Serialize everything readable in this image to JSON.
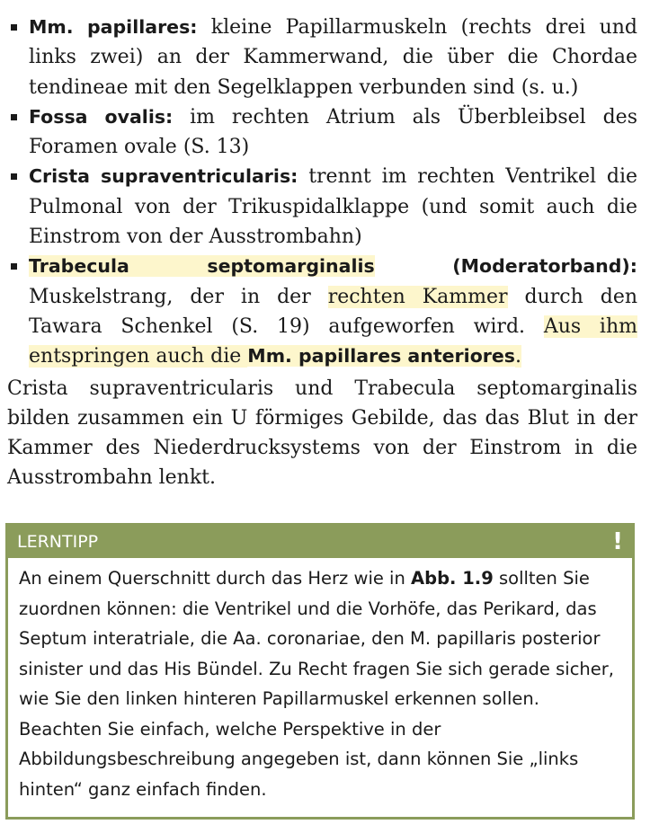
{
  "bullets": [
    {
      "term": "Mm. papillares:",
      "text": " kleine Papillarmuskeln (rechts drei und links zwei) an der Kammerwand, die über die Chordae tendineae mit den Segelklappen verbunden sind (s. u.)"
    },
    {
      "term": "Fossa ovalis:",
      "text": " im rechten Atrium als Überbleibsel des Foramen ovale (S. 13)"
    },
    {
      "term": "Crista supraventricularis:",
      "text": " trennt im rechten Ventrikel die Pulmonal  von der Trikuspidalklappe (und somit auch die Einstrom  von der Ausstrombahn)"
    },
    {
      "term": "Trabecula septomarginalis",
      "term2": " (Moderatorband):",
      "text_a": " Muskelstrang, der in der ",
      "hl_a": "rechten Kammer",
      "text_b": " durch den Tawara Schenkel (S. 19) aufgeworfen wird. ",
      "hl_b": "Aus ihm entspringen auch die ",
      "hl_c": "Mm. papillares anteriores",
      "hl_d": "."
    }
  ],
  "paragraph": "Crista supraventricularis und Trabecula septomarginalis bilden zusammen ein U förmiges Gebilde, das das Blut in der Kammer des Niederdrucksystems von der Einstrom  in die Ausstrombahn lenkt.",
  "tip": {
    "title": "LERNTIPP",
    "mark": "!",
    "text_a": "An einem Querschnitt durch das Herz wie in ",
    "ref": "Abb. 1.9",
    "text_b": " sollten Sie zuordnen können: die Ventrikel und die Vorhöfe, das Perikard, das Septum interatriale, die Aa. coronariae, den M. papillaris posterior sinister und das His Bündel. Zu Recht fragen Sie sich gerade sicher, wie Sie den linken hinteren Papillarmuskel erkennen sollen. Beachten Sie einfach, welche Perspektive in der Abbildungsbeschreibung angegeben ist, dann können Sie „links hinten“ ganz einfach finden."
  },
  "colors": {
    "accent": "#8b9c5b",
    "highlight": "#fdf6cc"
  }
}
